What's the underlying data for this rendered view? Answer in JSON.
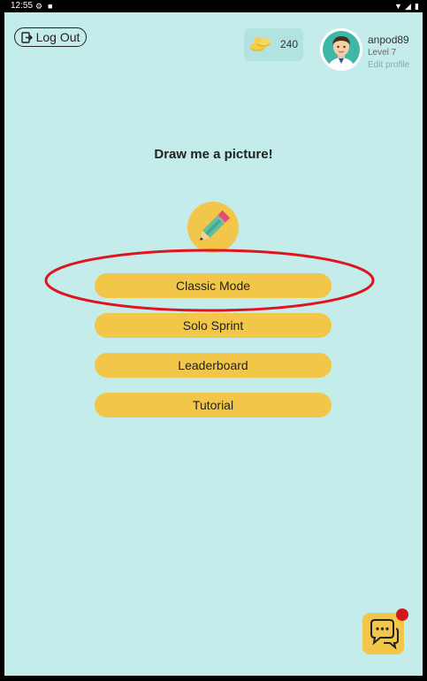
{
  "status_bar": {
    "time": "12:55",
    "icons": [
      "settings-icon",
      "storage-icon",
      "wifi-icon",
      "signal-icon",
      "battery-icon"
    ]
  },
  "header": {
    "logout_label": "Log Out",
    "coins_count": "240",
    "username": "anpod89",
    "level": "Level 7",
    "edit_profile_label": "Edit profile"
  },
  "main": {
    "title": "Draw me a picture!",
    "buttons": [
      {
        "label": "Classic Mode"
      },
      {
        "label": "Solo Sprint"
      },
      {
        "label": "Leaderboard"
      },
      {
        "label": "Tutorial"
      }
    ]
  },
  "colors": {
    "background": "#c3ecea",
    "button": "#f2c649",
    "highlight": "#e0141e",
    "notification": "#d0191f"
  },
  "icons": {
    "logout": "logout-icon",
    "coins": "coins-icon",
    "avatar": "avatar-icon",
    "pencil": "pencil-icon",
    "chat": "chat-icon"
  }
}
